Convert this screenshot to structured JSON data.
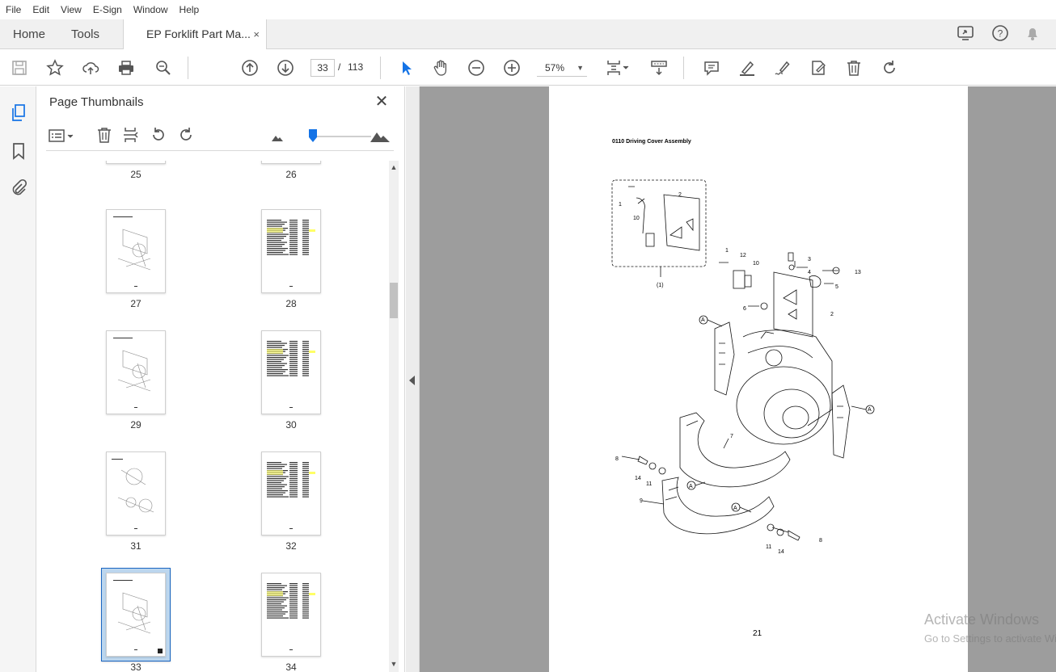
{
  "menu": [
    "File",
    "Edit",
    "View",
    "E-Sign",
    "Window",
    "Help"
  ],
  "tabs": {
    "home": "Home",
    "tools": "Tools",
    "document": "EP Forklift Part Ma...",
    "close": "×"
  },
  "toolbar": {
    "current_page": "33",
    "page_separator": "/",
    "total_pages": "113",
    "zoom": "57%",
    "icons": [
      "save-icon",
      "bookmark-star-icon",
      "upload-icon",
      "print-icon",
      "search-zoom-icon",
      "page-up-icon",
      "page-down-icon",
      "select-cursor-icon",
      "hand-icon",
      "zoom-out-icon",
      "zoom-in-icon",
      "fit-page-icon",
      "scroll-mode-icon",
      "comment-icon",
      "highlight-icon",
      "sign-icon",
      "fill-sign-icon",
      "delete-icon",
      "rotate-icon"
    ]
  },
  "panel": {
    "title": "Page Thumbnails",
    "close": "✕",
    "thumbnails": [
      {
        "label": "25"
      },
      {
        "label": "26"
      },
      {
        "label": "27"
      },
      {
        "label": "28"
      },
      {
        "label": "29"
      },
      {
        "label": "30"
      },
      {
        "label": "31"
      },
      {
        "label": "32"
      },
      {
        "label": "33",
        "selected": true
      },
      {
        "label": "34"
      }
    ]
  },
  "document": {
    "heading": "0110 Driving Cover Assembly",
    "page_number": "21",
    "callouts": [
      "1",
      "2",
      "10",
      "(1)",
      "1",
      "12",
      "10",
      "3",
      "4",
      "13",
      "5",
      "6",
      "2",
      "A",
      "A",
      "7",
      "8",
      "14",
      "11",
      "A",
      "9",
      "A",
      "11",
      "14",
      "8"
    ]
  },
  "watermark": {
    "line1": "Activate Windows",
    "line2": "Go to Settings to activate Windows."
  },
  "colors": {
    "accent": "#1473e6",
    "doc_bg": "#9d9d9d",
    "selected_thumb": "#bcd6ee",
    "highlight": "#ffff66"
  }
}
